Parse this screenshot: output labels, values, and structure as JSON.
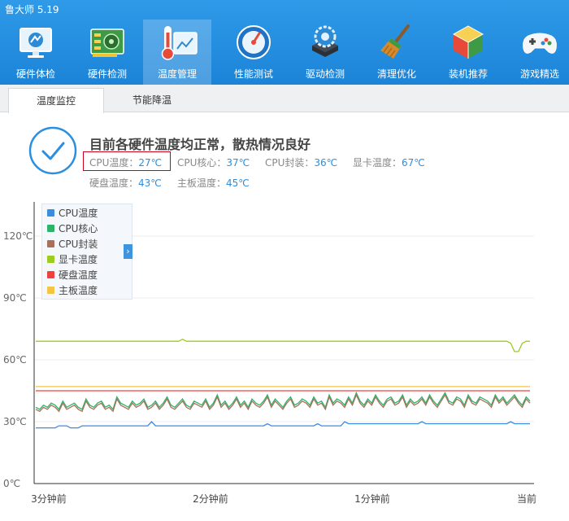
{
  "app": {
    "title": "鲁大师 5.19"
  },
  "toolbar": [
    {
      "label": "硬件体检",
      "icon": "monitor-icon",
      "active": false
    },
    {
      "label": "硬件检测",
      "icon": "circuit-board-icon",
      "active": false
    },
    {
      "label": "温度管理",
      "icon": "thermometer-chart-icon",
      "active": true
    },
    {
      "label": "性能测试",
      "icon": "speedometer-icon",
      "active": false
    },
    {
      "label": "驱动检测",
      "icon": "gear-drive-icon",
      "active": false
    },
    {
      "label": "清理优化",
      "icon": "broom-icon",
      "active": false
    },
    {
      "label": "装机推荐",
      "icon": "cube-icon",
      "active": false
    },
    {
      "label": "游戏精选",
      "icon": "gamepad-icon",
      "active": false
    }
  ],
  "subtabs": [
    {
      "label": "温度监控",
      "active": true
    },
    {
      "label": "节能降温",
      "active": false
    }
  ],
  "status": {
    "headline": "目前各硬件温度均正常，散热情况良好",
    "icon": "checkmark-circle-icon",
    "readings": [
      {
        "label": "CPU温度：",
        "value": "27℃"
      },
      {
        "label": "CPU核心：",
        "value": "37℃"
      },
      {
        "label": "CPU封装：",
        "value": "36℃"
      },
      {
        "label": "显卡温度：",
        "value": "67℃"
      },
      {
        "label": "硬盘温度：",
        "value": "43℃"
      },
      {
        "label": "主板温度：",
        "value": "45℃"
      }
    ]
  },
  "chart_data": {
    "type": "line",
    "x_tick_labels": [
      "3分钟前",
      "2分钟前",
      "1分钟前",
      "当前"
    ],
    "y_tick_labels": [
      "0℃",
      "30℃",
      "60℃",
      "90℃",
      "120℃"
    ],
    "ylim": [
      0,
      120
    ],
    "grid": true,
    "legend_position": "top-left",
    "series": [
      {
        "name": "CPU温度",
        "color": "#3b8de0",
        "base": 27.5,
        "noise": 0.4,
        "values": [
          27,
          27,
          27,
          27,
          27,
          27,
          28,
          28,
          28,
          27,
          27,
          27,
          28,
          28,
          28,
          28,
          28,
          28,
          28,
          28,
          28,
          28,
          28,
          28,
          28,
          28,
          28,
          28,
          28,
          28,
          30,
          28,
          28,
          28,
          28,
          28,
          28,
          28,
          28,
          28,
          28,
          28,
          28,
          28,
          28,
          28,
          28,
          28,
          28,
          28,
          28,
          28,
          28,
          28,
          28,
          28,
          28,
          28,
          28,
          28,
          29,
          28,
          28,
          28,
          28,
          28,
          28,
          28,
          28,
          28,
          28,
          28,
          28,
          29,
          28,
          28,
          28,
          28,
          28,
          28,
          30,
          29,
          29,
          29,
          29,
          29,
          29,
          29,
          29,
          29,
          29,
          29,
          29,
          29,
          29,
          29,
          29,
          29,
          29,
          29,
          30,
          29,
          29,
          29,
          29,
          29,
          29,
          29,
          29,
          29,
          29,
          29,
          29,
          29,
          29,
          29,
          29,
          29,
          29,
          29,
          29,
          29,
          29,
          30,
          29,
          29,
          29,
          29,
          29
        ]
      },
      {
        "name": "CPU核心",
        "color": "#2fb36a",
        "values": [
          37,
          36,
          38,
          37,
          39,
          38,
          36,
          40,
          37,
          38,
          39,
          37,
          36,
          41,
          38,
          37,
          39,
          40,
          37,
          38,
          36,
          42,
          39,
          38,
          37,
          40,
          38,
          39,
          41,
          37,
          38,
          40,
          37,
          39,
          42,
          38,
          37,
          39,
          41,
          38,
          37,
          40,
          39,
          38,
          41,
          37,
          39,
          43,
          38,
          40,
          37,
          39,
          42,
          38,
          40,
          37,
          41,
          39,
          38,
          40,
          43,
          38,
          41,
          39,
          37,
          40,
          42,
          38,
          39,
          41,
          40,
          38,
          42,
          39,
          40,
          37,
          43,
          39,
          41,
          40,
          38,
          42,
          39,
          44,
          40,
          38,
          41,
          39,
          43,
          40,
          38,
          41,
          42,
          39,
          40,
          43,
          38,
          41,
          39,
          40,
          42,
          39,
          43,
          40,
          38,
          41,
          44,
          40,
          39,
          42,
          41,
          38,
          43,
          40,
          39,
          42,
          41,
          40,
          38,
          43,
          40,
          42,
          39,
          41,
          43,
          40,
          38,
          42,
          40
        ]
      },
      {
        "name": "CPU封装",
        "color": "#a8715a",
        "values": [
          36,
          35,
          37,
          36,
          38,
          37,
          35,
          39,
          36,
          37,
          38,
          36,
          35,
          40,
          37,
          36,
          38,
          39,
          36,
          37,
          35,
          41,
          38,
          37,
          36,
          39,
          37,
          38,
          40,
          36,
          37,
          39,
          36,
          38,
          41,
          37,
          36,
          38,
          40,
          37,
          36,
          39,
          38,
          37,
          40,
          36,
          38,
          42,
          37,
          39,
          36,
          38,
          41,
          37,
          39,
          36,
          40,
          38,
          37,
          39,
          42,
          37,
          40,
          38,
          36,
          39,
          41,
          37,
          38,
          40,
          39,
          37,
          41,
          38,
          39,
          36,
          42,
          38,
          40,
          39,
          37,
          41,
          38,
          43,
          39,
          37,
          40,
          38,
          42,
          39,
          37,
          40,
          41,
          38,
          39,
          42,
          37,
          40,
          38,
          39,
          41,
          38,
          42,
          39,
          37,
          40,
          43,
          39,
          38,
          41,
          40,
          37,
          42,
          39,
          38,
          41,
          40,
          39,
          37,
          42,
          39,
          41,
          38,
          40,
          42,
          39,
          37,
          41,
          39
        ]
      },
      {
        "name": "显卡温度",
        "color": "#9ccc1c",
        "values": [
          69,
          69,
          69,
          69,
          69,
          69,
          69,
          69,
          69,
          69,
          69,
          69,
          69,
          69,
          69,
          69,
          69,
          69,
          69,
          69,
          69,
          69,
          69,
          69,
          69,
          69,
          69,
          69,
          69,
          69,
          69,
          69,
          69,
          69,
          69,
          69,
          69,
          69,
          70,
          69,
          69,
          69,
          69,
          69,
          69,
          69,
          69,
          69,
          69,
          69,
          69,
          69,
          69,
          69,
          69,
          69,
          69,
          69,
          69,
          69,
          69,
          69,
          69,
          69,
          69,
          69,
          69,
          69,
          69,
          69,
          69,
          69,
          69,
          69,
          69,
          69,
          69,
          69,
          69,
          69,
          69,
          69,
          69,
          69,
          69,
          69,
          69,
          69,
          69,
          69,
          69,
          69,
          69,
          69,
          69,
          69,
          69,
          69,
          69,
          69,
          69,
          69,
          69,
          69,
          69,
          69,
          69,
          69,
          69,
          69,
          69,
          69,
          69,
          69,
          69,
          69,
          69,
          69,
          69,
          69,
          69,
          69,
          69,
          68,
          64,
          64,
          68,
          69,
          69
        ]
      },
      {
        "name": "硬盘温度",
        "color": "#f0423c",
        "values": [
          45,
          45,
          45,
          45,
          45,
          45,
          45,
          45,
          45,
          45,
          45,
          45,
          45,
          45,
          45,
          45,
          45,
          45,
          45,
          45,
          45,
          45,
          45,
          45,
          45,
          45,
          45,
          45,
          45,
          45,
          45,
          45,
          45,
          45,
          45,
          45,
          45,
          45,
          45,
          45,
          45,
          45,
          45,
          45,
          45,
          45,
          45,
          45,
          45,
          45,
          45,
          45,
          45,
          45,
          45,
          45,
          45,
          45,
          45,
          45,
          45,
          45,
          45,
          45,
          45,
          45,
          45,
          45,
          45,
          45,
          45,
          45,
          45,
          45,
          45,
          45,
          45,
          45,
          45,
          45,
          45,
          45,
          45,
          45,
          45,
          45,
          45,
          45,
          45,
          45,
          45,
          45,
          45,
          45,
          45,
          45,
          45,
          45,
          45,
          45,
          45,
          45,
          45,
          45,
          45,
          45,
          45,
          45,
          45,
          45,
          45,
          45,
          45,
          45,
          45,
          45,
          45,
          45,
          45,
          45,
          45,
          45,
          45,
          45,
          45,
          45,
          45,
          45,
          45
        ]
      },
      {
        "name": "主板温度",
        "color": "#f4c542",
        "values": [
          47,
          47,
          47,
          47,
          47,
          47,
          47,
          47,
          47,
          47,
          47,
          47,
          47,
          47,
          47,
          47,
          47,
          47,
          47,
          47,
          47,
          47,
          47,
          47,
          47,
          47,
          47,
          47,
          47,
          47,
          47,
          47,
          47,
          47,
          47,
          47,
          47,
          47,
          47,
          47,
          47,
          47,
          47,
          47,
          47,
          47,
          47,
          47,
          47,
          47,
          47,
          47,
          47,
          47,
          47,
          47,
          47,
          47,
          47,
          47,
          47,
          47,
          47,
          47,
          47,
          47,
          47,
          47,
          47,
          47,
          47,
          47,
          47,
          47,
          47,
          47,
          47,
          47,
          47,
          47,
          47,
          47,
          47,
          47,
          47,
          47,
          47,
          47,
          47,
          47,
          47,
          47,
          47,
          47,
          47,
          47,
          47,
          47,
          47,
          47,
          47,
          47,
          47,
          47,
          47,
          47,
          47,
          47,
          47,
          47,
          47,
          47,
          47,
          47,
          47,
          47,
          47,
          47,
          47,
          47,
          47,
          47,
          47,
          47,
          47,
          47,
          47,
          47,
          47
        ]
      }
    ]
  }
}
